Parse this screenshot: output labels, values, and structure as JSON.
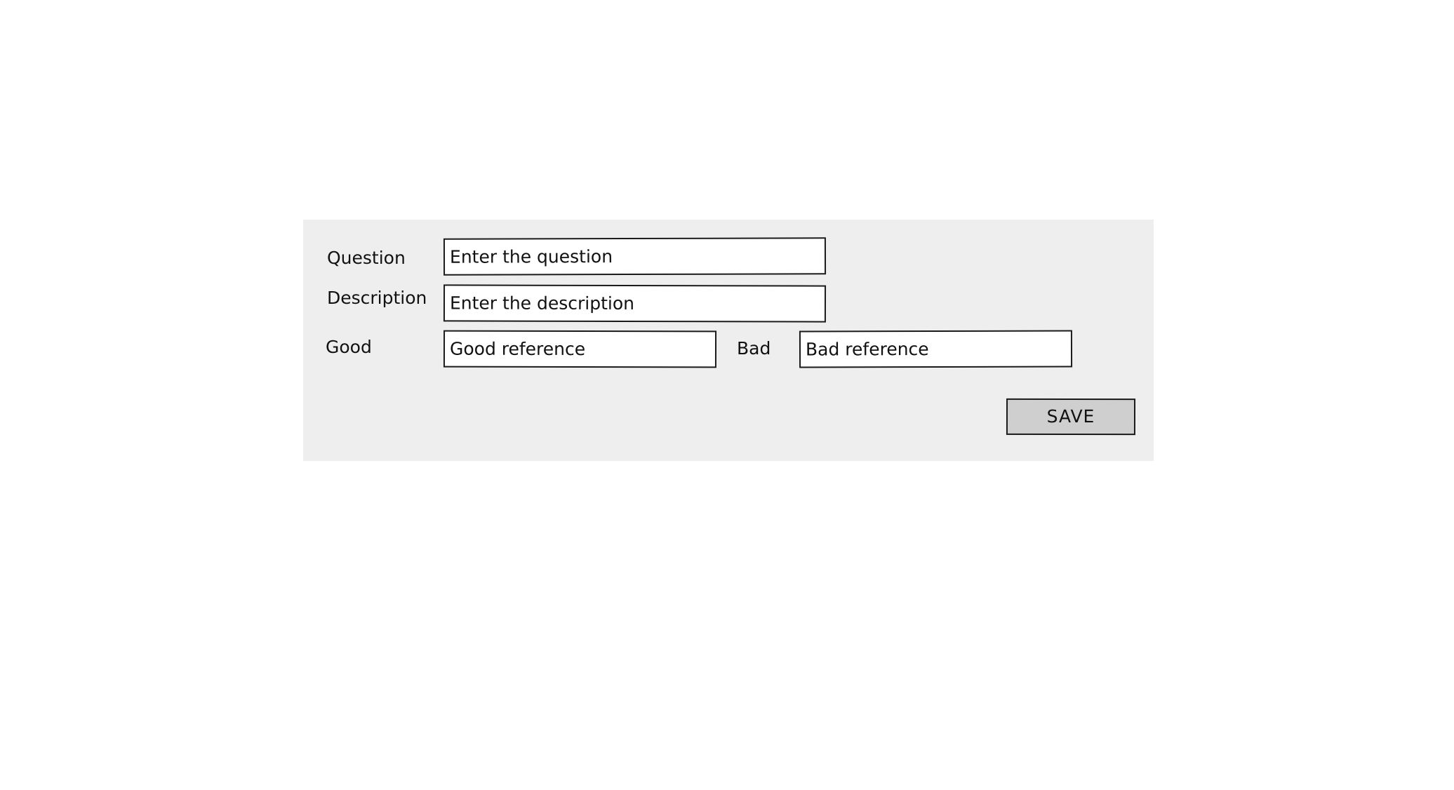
{
  "form": {
    "question": {
      "label": "Question",
      "value": "Enter the question"
    },
    "description": {
      "label": "Description",
      "value": "Enter the description"
    },
    "good": {
      "label": "Good",
      "value": "Good reference"
    },
    "bad": {
      "label": "Bad",
      "value": "Bad reference"
    },
    "save_label": "SAVE"
  },
  "colors": {
    "panel_background": "#eeeeee",
    "field_background": "#ffffff",
    "field_border": "#1a1a1a",
    "button_background": "#cfcfcf",
    "text": "#111111"
  }
}
